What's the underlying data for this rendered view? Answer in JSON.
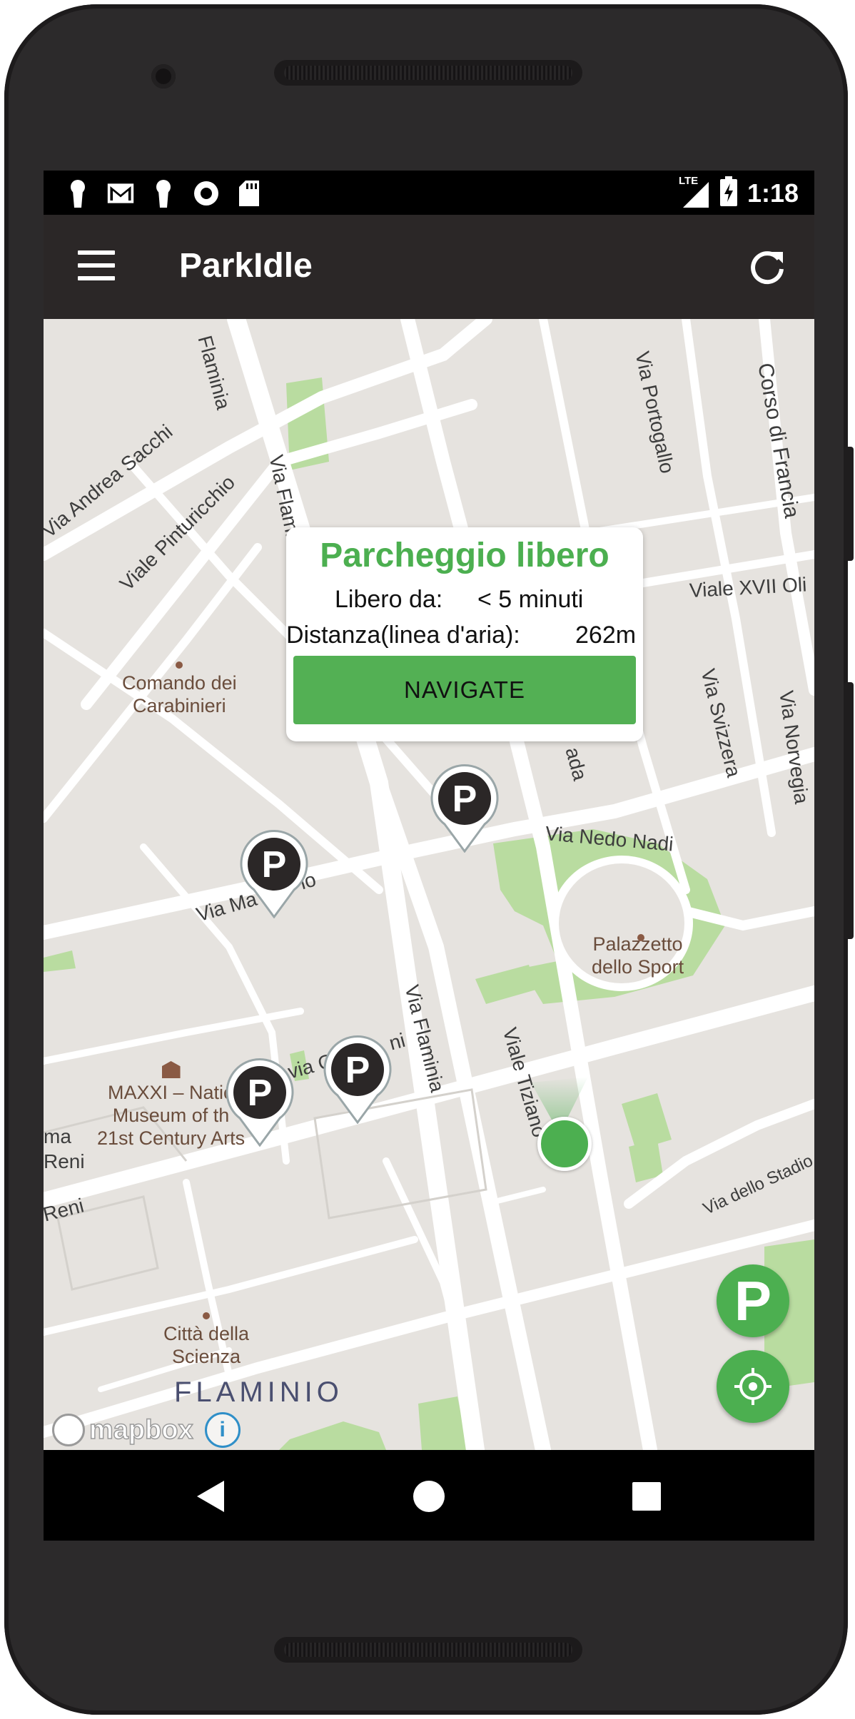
{
  "app": {
    "title": "ParkIdle"
  },
  "status_bar": {
    "time": "1:18",
    "network": "LTE"
  },
  "popup": {
    "title": "Parcheggio libero",
    "free_since_label": "Libero da:",
    "free_since_value": "< 5 minuti",
    "distance_label": "Distanza(linea d'aria):",
    "distance_value": "262m",
    "navigate_label": "NAVIGATE"
  },
  "map": {
    "streets": [
      "Flaminia",
      "Via Andrea Sacchi",
      "Viale Pinturicchio",
      "Via Flaminia",
      "Via Portogallo",
      "Corso di Francia",
      "Viale XVII Oli",
      "Via Svizzera",
      "Via Norvegia",
      "ada",
      "Via Nedo Nadi",
      "Via Ma",
      "lo",
      "Via Flaminia",
      "Viale Tiziano",
      "via Guid",
      "ni",
      "Via dello Stadio",
      "ma",
      "Reni",
      "Reni"
    ],
    "pois": [
      {
        "name": "Comando dei\nCarabinieri"
      },
      {
        "name": "Palazzetto\ndello Sport"
      },
      {
        "name": "MAXXI – Natio\nMuseum of th\n21st Century Arts"
      },
      {
        "name": "Città della\nScienza"
      }
    ],
    "district": "FLAMINIO",
    "parking_marker_glyph": "P",
    "attribution": "mapbox",
    "info_glyph": "i"
  },
  "fabs": {
    "parking_glyph": "P"
  },
  "colors": {
    "accent": "#4caf50",
    "appbar": "#2b2727",
    "map_bg": "#e6e3df",
    "park": "#b9dca0"
  }
}
